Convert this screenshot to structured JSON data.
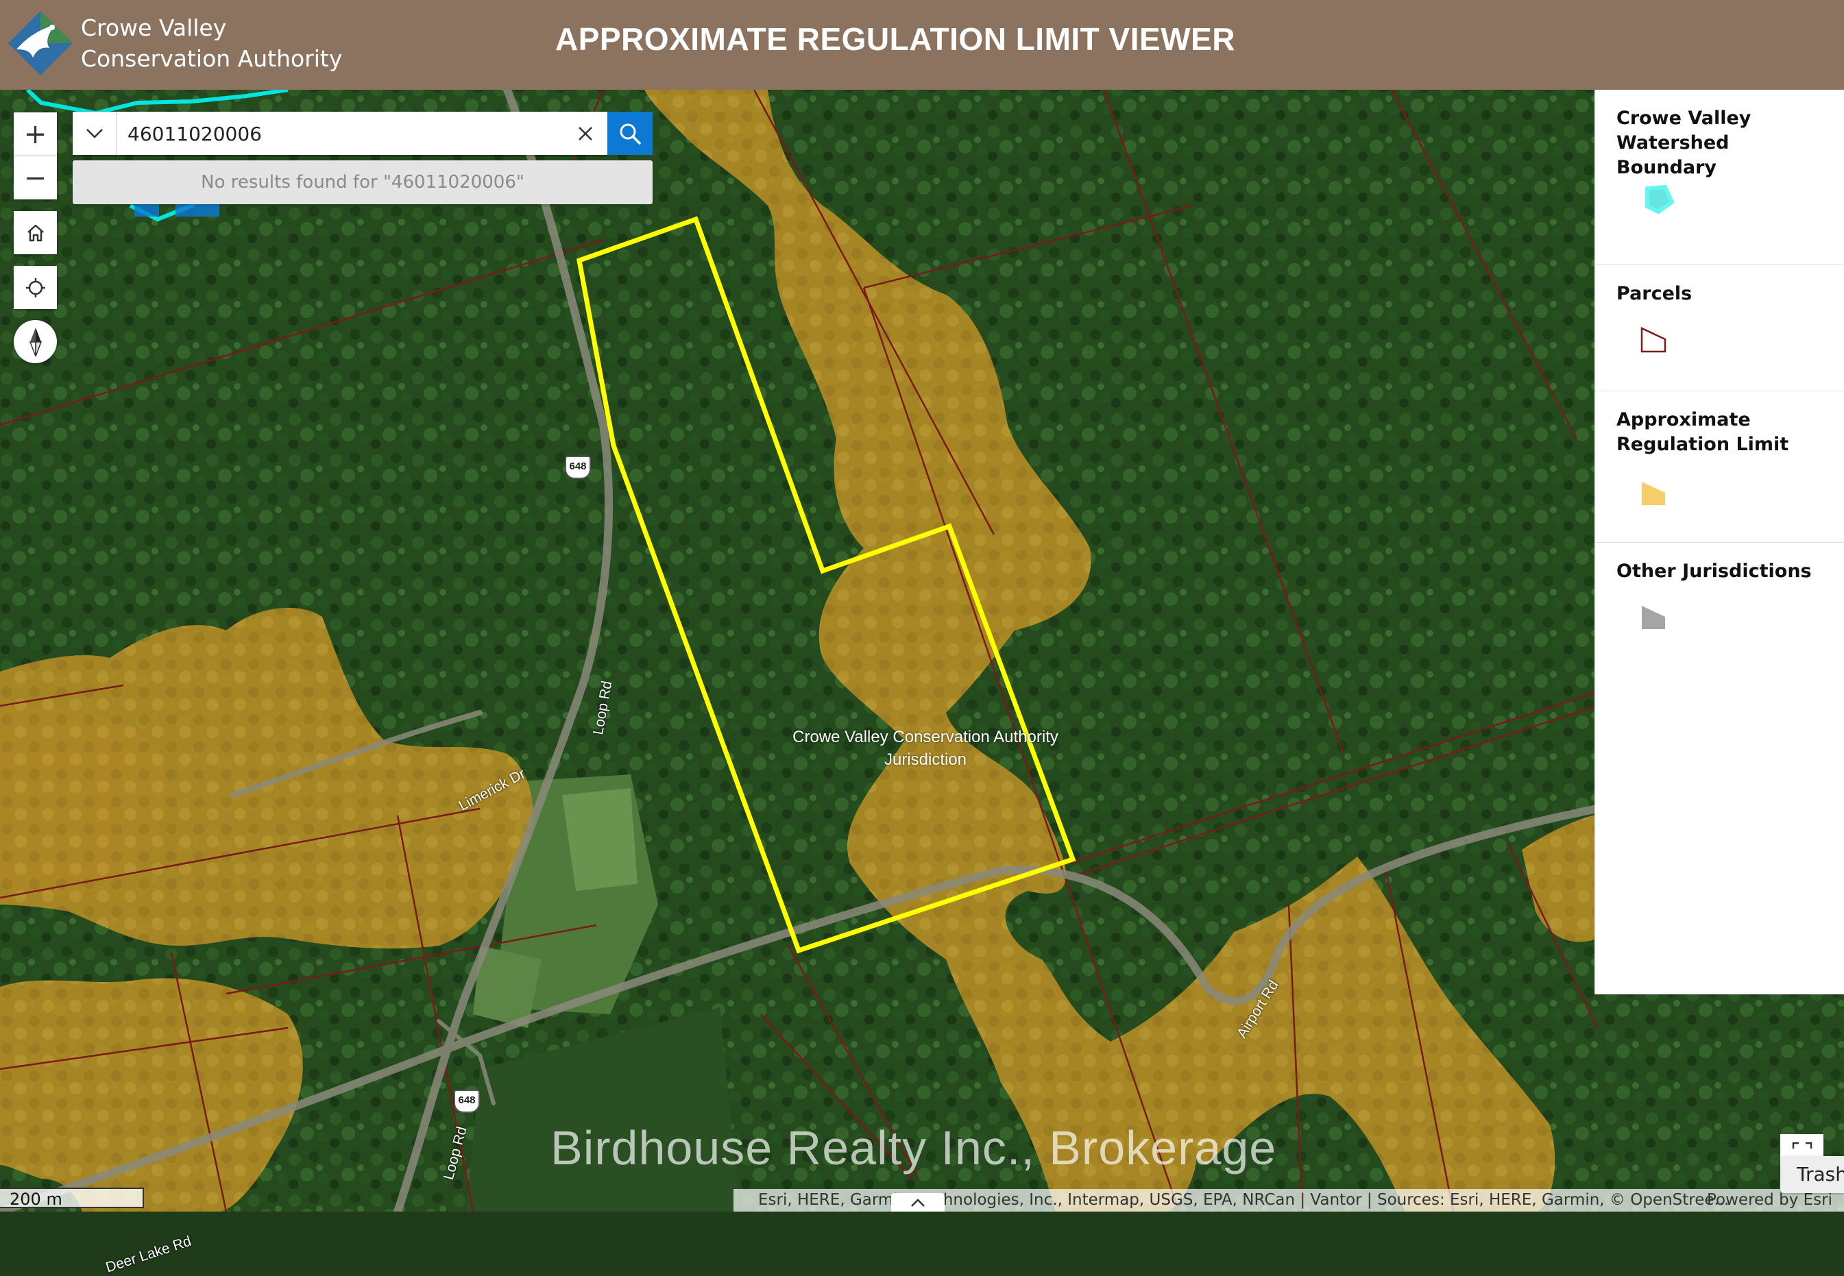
{
  "header": {
    "org_line1": "Crowe Valley",
    "org_line2": "Conservation Authority",
    "title": "APPROXIMATE REGULATION LIMIT VIEWER"
  },
  "controls": {
    "zoom_in": "+",
    "zoom_out": "−",
    "icons": [
      "home-icon",
      "locate-icon",
      "compass-icon"
    ]
  },
  "search": {
    "value": "46011020006",
    "no_results": "No results found for \"46011020006\""
  },
  "map": {
    "jurisdiction_line1": "Crowe Valley Conservation Authority",
    "jurisdiction_line2": "Jurisdiction",
    "roads": {
      "loop_rd_north": "Loop Rd",
      "loop_rd_south": "Loop Rd",
      "limerick_dr": "Limerick Dr",
      "airport_rd": "Airport Rd",
      "deer_lake_rd": "Deer Lake Rd",
      "highway_shield": "648"
    },
    "colors": {
      "parcel_outline": "#7a1a1a",
      "regulation_limit": "#d9a928",
      "selected_parcel": "#ffff00",
      "watershed_boundary": "#00e5e0"
    }
  },
  "legend": {
    "items": [
      {
        "label": "Crowe Valley Watershed Boundary"
      },
      {
        "label": "Parcels"
      },
      {
        "label": "Approximate Regulation Limit"
      },
      {
        "label": "Other Jurisdictions"
      }
    ]
  },
  "scale": "200 m",
  "attribution": {
    "text": "Esri, HERE, Garmin, Technologies, Inc., Intermap, USGS, EPA, NRCan | Vantor | Sources: Esri, HERE, Garmin, © OpenStree...",
    "powered": "Powered by Esri"
  },
  "watermark": "Birdhouse Realty Inc., Brokerage",
  "trash": "Trash"
}
